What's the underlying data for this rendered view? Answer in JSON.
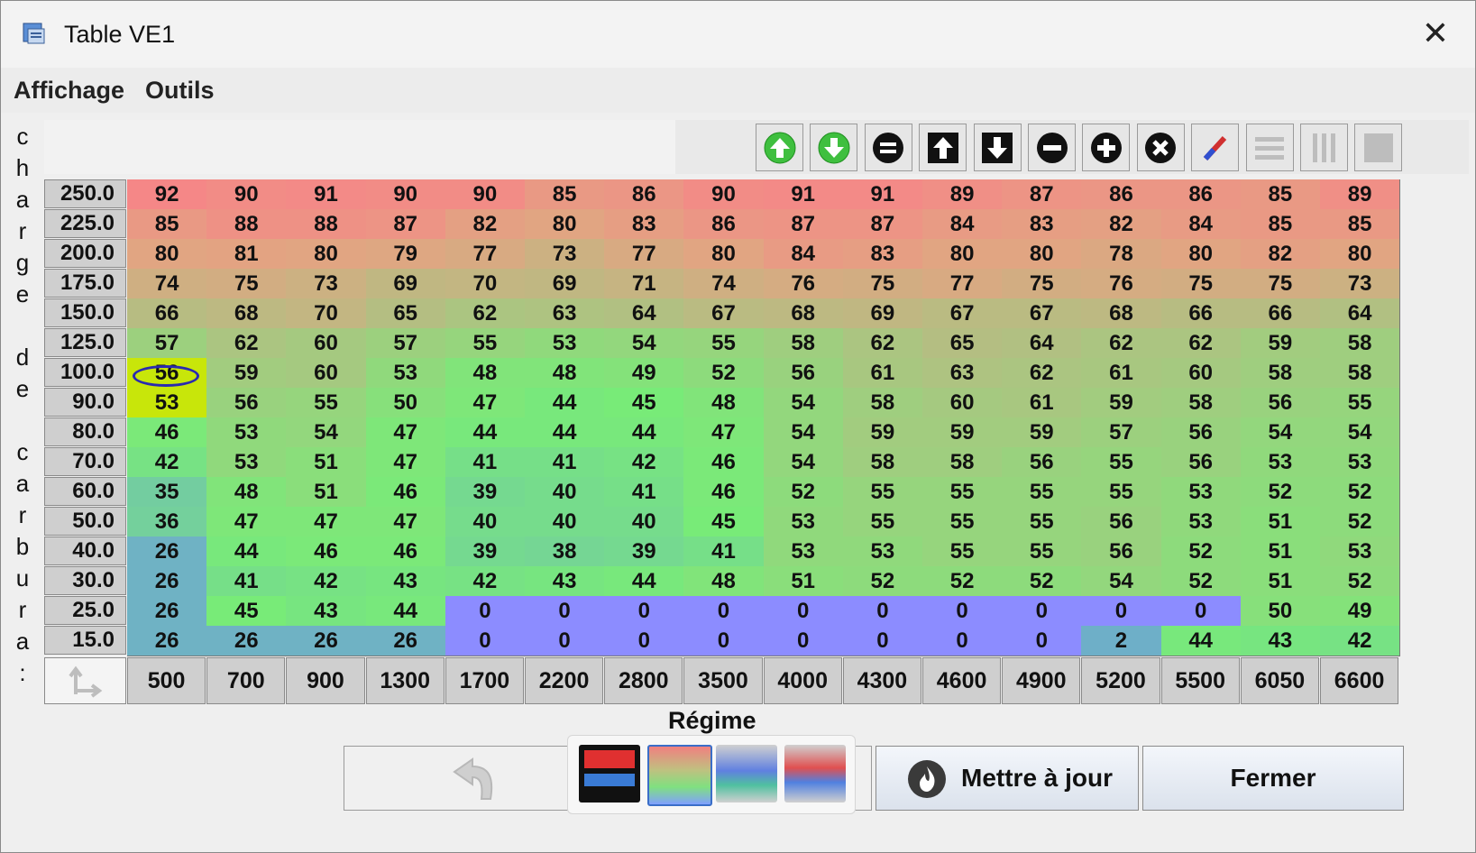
{
  "window": {
    "title": "Table VE1"
  },
  "menu": [
    "Affichage",
    "Outils"
  ],
  "axes": {
    "y_label": "charge de carbura:",
    "x_label": "Régime"
  },
  "toolbar": {
    "buttons": [
      "up-green-icon",
      "down-green-icon",
      "equals-icon",
      "arrow-up-icon",
      "arrow-down-icon",
      "minus-icon",
      "plus-icon",
      "clear-icon",
      "pencil-icon",
      "rows-icon",
      "columns-icon",
      "fill-icon"
    ]
  },
  "table": {
    "rows": [
      "250.0",
      "225.0",
      "200.0",
      "175.0",
      "150.0",
      "125.0",
      "100.0",
      "90.0",
      "80.0",
      "70.0",
      "60.0",
      "50.0",
      "40.0",
      "30.0",
      "25.0",
      "15.0"
    ],
    "cols": [
      "500",
      "700",
      "900",
      "1300",
      "1700",
      "2200",
      "2800",
      "3500",
      "4000",
      "4300",
      "4600",
      "4900",
      "5200",
      "5500",
      "6050",
      "6600"
    ],
    "values": [
      [
        92,
        90,
        91,
        90,
        90,
        85,
        86,
        90,
        91,
        91,
        89,
        87,
        86,
        86,
        85,
        89
      ],
      [
        85,
        88,
        88,
        87,
        82,
        80,
        83,
        86,
        87,
        87,
        84,
        83,
        82,
        84,
        85,
        85
      ],
      [
        80,
        81,
        80,
        79,
        77,
        73,
        77,
        80,
        84,
        83,
        80,
        80,
        78,
        80,
        82,
        80
      ],
      [
        74,
        75,
        73,
        69,
        70,
        69,
        71,
        74,
        76,
        75,
        77,
        75,
        76,
        75,
        75,
        73
      ],
      [
        66,
        68,
        70,
        65,
        62,
        63,
        64,
        67,
        68,
        69,
        67,
        67,
        68,
        66,
        66,
        64
      ],
      [
        57,
        62,
        60,
        57,
        55,
        53,
        54,
        55,
        58,
        62,
        65,
        64,
        62,
        62,
        59,
        58
      ],
      [
        56,
        59,
        60,
        53,
        48,
        48,
        49,
        52,
        56,
        61,
        63,
        62,
        61,
        60,
        58,
        58
      ],
      [
        53,
        56,
        55,
        50,
        47,
        44,
        45,
        48,
        54,
        58,
        60,
        61,
        59,
        58,
        56,
        55
      ],
      [
        46,
        53,
        54,
        47,
        44,
        44,
        44,
        47,
        54,
        59,
        59,
        59,
        57,
        56,
        54,
        54
      ],
      [
        42,
        53,
        51,
        47,
        41,
        41,
        42,
        46,
        54,
        58,
        58,
        56,
        55,
        56,
        53,
        53
      ],
      [
        35,
        48,
        51,
        46,
        39,
        40,
        41,
        46,
        52,
        55,
        55,
        55,
        55,
        53,
        52,
        52
      ],
      [
        36,
        47,
        47,
        47,
        40,
        40,
        40,
        45,
        53,
        55,
        55,
        55,
        56,
        53,
        51,
        52
      ],
      [
        26,
        44,
        46,
        46,
        39,
        38,
        39,
        41,
        53,
        53,
        55,
        55,
        56,
        52,
        51,
        53
      ],
      [
        26,
        41,
        42,
        43,
        42,
        43,
        44,
        48,
        51,
        52,
        52,
        52,
        54,
        52,
        51,
        52
      ],
      [
        26,
        45,
        43,
        44,
        0,
        0,
        0,
        0,
        0,
        0,
        0,
        0,
        0,
        0,
        50,
        49
      ],
      [
        26,
        26,
        26,
        26,
        0,
        0,
        0,
        0,
        0,
        0,
        0,
        0,
        2,
        44,
        43,
        42
      ]
    ],
    "highlighted": [
      [
        6,
        0
      ],
      [
        7,
        0
      ]
    ],
    "colors": {
      "zero": "#8c8cff",
      "highlight": "#c8e60a"
    }
  },
  "buttons": {
    "update": "Mettre à jour",
    "close": "Fermer"
  }
}
